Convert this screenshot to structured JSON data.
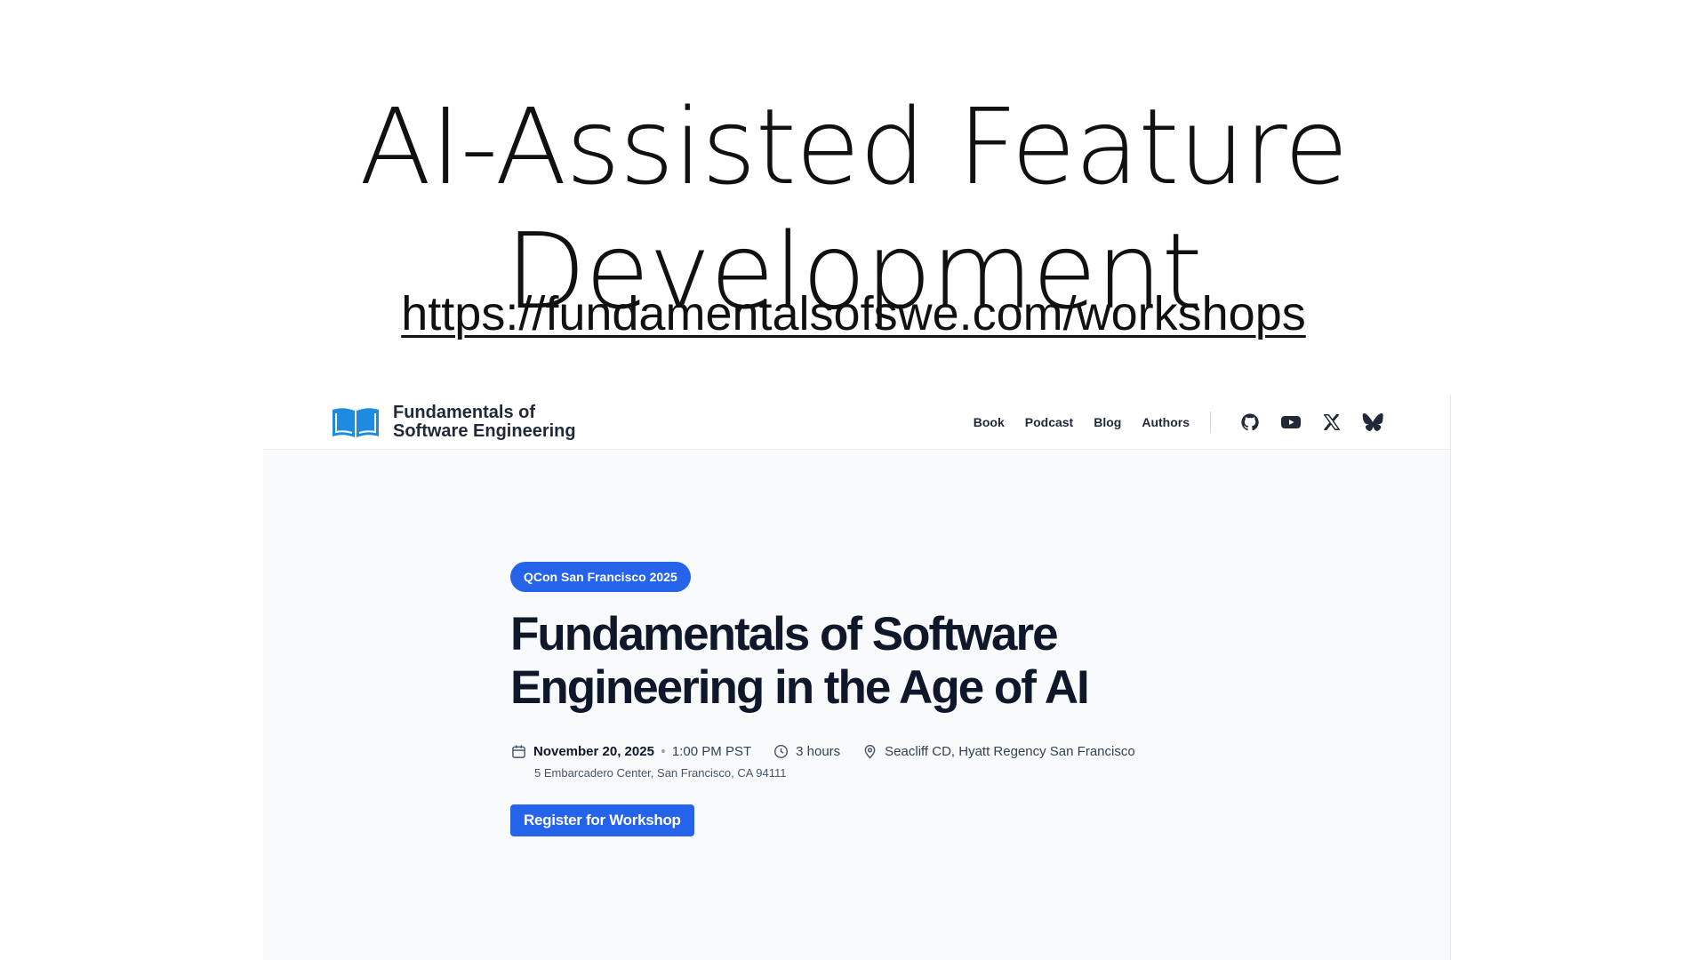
{
  "slide": {
    "title": "AI-Assisted Feature Development",
    "url": "https://fundamentalsofswe.com/workshops"
  },
  "site": {
    "brand": {
      "line1": "Fundamentals of",
      "line2": "Software Engineering",
      "logo_icon": "open-book-icon"
    },
    "nav": {
      "items": [
        "Book",
        "Podcast",
        "Blog",
        "Authors"
      ],
      "social_icons": [
        "github-icon",
        "youtube-icon",
        "x-icon",
        "bluesky-icon"
      ]
    },
    "event": {
      "badge": "QCon San Francisco 2025",
      "title_line1": "Fundamentals of Software",
      "title_line2": "Engineering in the Age of AI",
      "date": "November 20, 2025",
      "time": "1:00 PM PST",
      "duration": "3 hours",
      "venue": "Seacliff CD, Hyatt Regency San Francisco",
      "address": "5 Embarcadero Center, San Francisco, CA 94111",
      "register_label": "Register for Workshop"
    },
    "colors": {
      "accent": "#2563eb",
      "logo_blue": "#1d8ce0",
      "page_bg": "#f8fafc",
      "heading": "#0f172a"
    }
  }
}
